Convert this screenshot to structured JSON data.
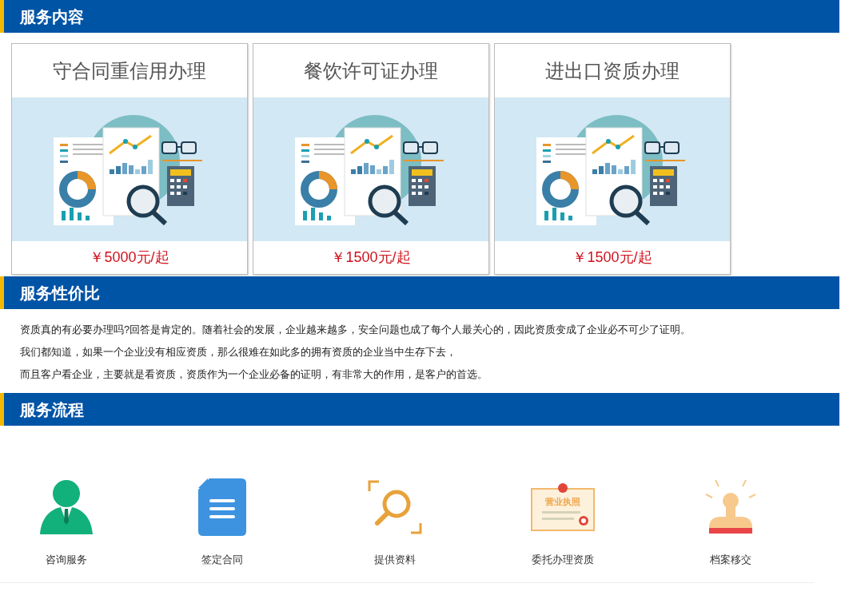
{
  "sections": [
    {
      "title": "服务内容",
      "kind": "cards",
      "cards": [
        {
          "title": "守合同重信用办理",
          "price": "￥5000元/起"
        },
        {
          "title": "餐饮许可证办理",
          "price": "￥1500元/起"
        },
        {
          "title": "进出口资质办理",
          "price": "￥1500元/起"
        }
      ]
    },
    {
      "title": "服务性价比",
      "kind": "text",
      "paragraphs": [
        "资质真的有必要办理吗?回答是肯定的。随着社会的发展，企业越来越多，安全问题也成了每个人最关心的，因此资质变成了企业必不可少了证明。",
        "我们都知道，如果一个企业没有相应资质，那么很难在如此多的拥有资质的企业当中生存下去，",
        "而且客户看企业，主要就是看资质，资质作为一个企业必备的证明，有非常大的作用，是客户的首选。"
      ]
    },
    {
      "title": "服务流程",
      "kind": "steps",
      "steps": [
        {
          "label": "咨询服务",
          "kind": "person"
        },
        {
          "label": "签定合同",
          "kind": "document"
        },
        {
          "label": "提供资料",
          "kind": "search"
        },
        {
          "label": "委托办理资质",
          "kind": "certificate",
          "icon_text": "营业执照"
        },
        {
          "label": "档案移交",
          "kind": "stamp"
        }
      ]
    }
  ]
}
